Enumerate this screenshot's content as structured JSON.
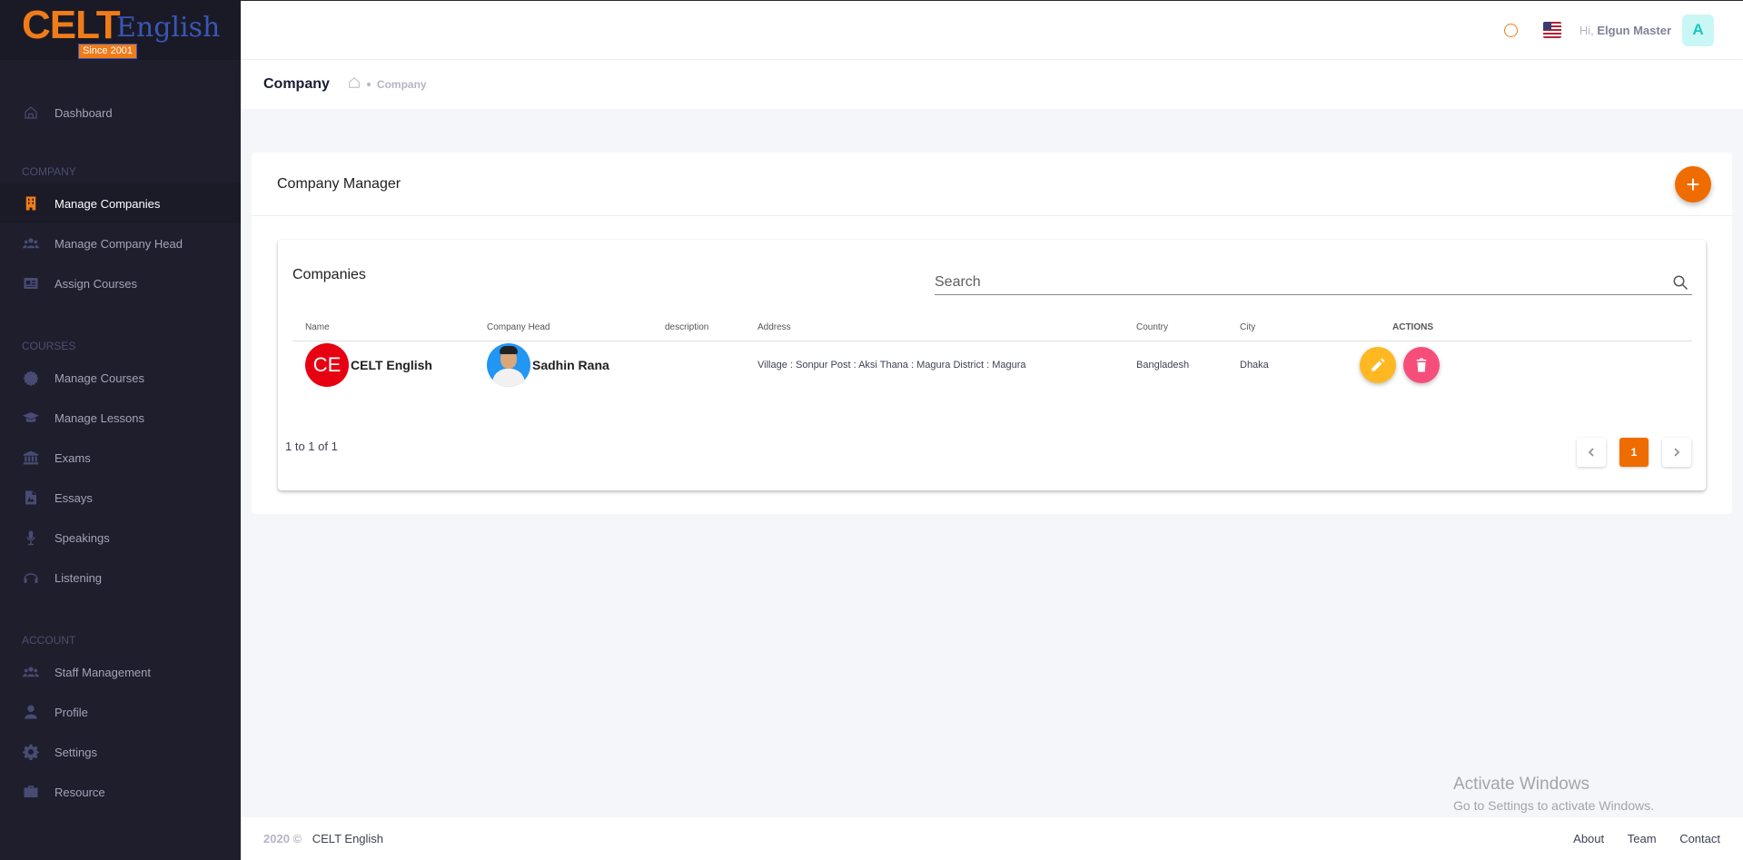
{
  "brand": {
    "logo_main": "CELT",
    "logo_sub": "English",
    "logo_since": "Since 2001"
  },
  "header": {
    "greeting": "Hi,",
    "user_name": "Elgun Master",
    "avatar_letter": "A"
  },
  "sidebar": {
    "dashboard": "Dashboard",
    "sections": [
      {
        "label": "COMPANY",
        "items": [
          "Manage Companies",
          "Manage Company Head",
          "Assign Courses"
        ]
      },
      {
        "label": "COURSES",
        "items": [
          "Manage Courses",
          "Manage Lessons",
          "Exams",
          "Essays",
          "Speakings",
          "Listening"
        ]
      },
      {
        "label": "ACCOUNT",
        "items": [
          "Staff Management",
          "Profile",
          "Settings",
          "Resource"
        ]
      }
    ],
    "active_item": "Manage Companies"
  },
  "subheader": {
    "title": "Company",
    "breadcrumb": "Company"
  },
  "card": {
    "title": "Company Manager",
    "add_icon": "+"
  },
  "table": {
    "title": "Companies",
    "search_placeholder": "Search",
    "columns": [
      "Name",
      "Company Head",
      "description",
      "Address",
      "Country",
      "City",
      "ACTIONS"
    ],
    "rows": [
      {
        "badge": "CE",
        "name": "CELT English",
        "head": "Sadhin Rana",
        "description": "",
        "address": "Village : Sonpur Post : Aksi Thana : Magura District : Magura",
        "country": "Bangladesh",
        "city": "Dhaka"
      }
    ],
    "range_text": "1 to 1 of 1",
    "current_page": "1"
  },
  "footer": {
    "year": "2020 ©",
    "brand": "CELT English",
    "links": [
      "About",
      "Team",
      "Contact"
    ]
  },
  "watermark": {
    "line1": "Activate Windows",
    "line2": "Go to Settings to activate Windows."
  },
  "colors": {
    "accent": "#ef6c00",
    "sidebar_bg": "#1e1e2d",
    "edit": "#ffb822",
    "delete": "#f64e7a",
    "badge": "#e60012"
  }
}
